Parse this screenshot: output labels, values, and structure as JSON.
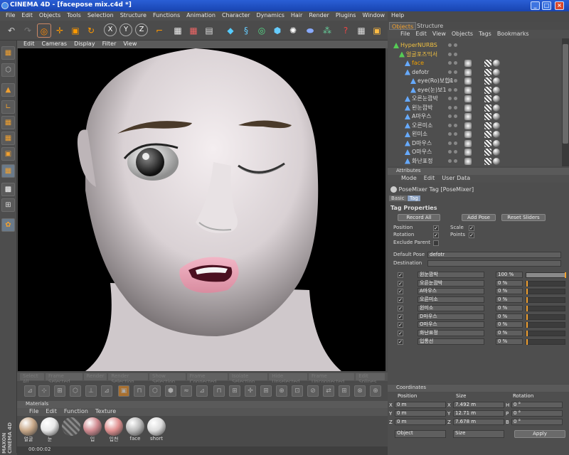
{
  "window": {
    "title": "CINEMA 4D - [facepose mix.c4d *]",
    "min": "_",
    "max": "□",
    "close": "×"
  },
  "menubar": [
    "File",
    "Edit",
    "Objects",
    "Tools",
    "Selection",
    "Structure",
    "Functions",
    "Animation",
    "Character",
    "Dynamics",
    "Hair",
    "Render",
    "Plugins",
    "Window",
    "Help"
  ],
  "viewport": {
    "menu": [
      "Edit",
      "Cameras",
      "Display",
      "Filter",
      "View"
    ]
  },
  "greyed_buttons": [
    "Select All",
    "Frame Selected",
    "Render",
    "Render Selection",
    "Show Selection",
    "Frame Connected",
    "Isolate Selection",
    "Hide Unselected",
    "Frame Unconnected",
    "Edit Splines"
  ],
  "materials": {
    "title": "Materials",
    "menu": [
      "File",
      "Edit",
      "Function",
      "Texture"
    ],
    "items": [
      {
        "label": "얼굴",
        "color": "#c8a888"
      },
      {
        "label": "눈",
        "color": "#e8e8e8"
      },
      {
        "label": "",
        "color": "stripe"
      },
      {
        "label": "입",
        "color": "#d08a90"
      },
      {
        "label": "입천",
        "color": "#e09090"
      },
      {
        "label": "face",
        "color": "#bbb"
      },
      {
        "label": "short",
        "color": "#ddd"
      }
    ]
  },
  "status": {
    "time": "00:00:02"
  },
  "maxon": "MAXON CINEMA 4D",
  "objects": {
    "tabs": [
      "Objects",
      "Structure"
    ],
    "menu": [
      "File",
      "Edit",
      "View",
      "Objects",
      "Tags",
      "Bookmarks"
    ],
    "tree": [
      {
        "name": "HyperNURBS",
        "indent": 0,
        "color": "#f0c040"
      },
      {
        "name": "얼굴포즈믹서",
        "indent": 1,
        "color": "#f0c040"
      },
      {
        "name": "face",
        "indent": 2,
        "color": "#f0a000"
      },
      {
        "name": "defotr",
        "indent": 2,
        "color": "#ddd"
      },
      {
        "name": "eye(Ro)보합1",
        "indent": 3,
        "color": "#ddd"
      },
      {
        "name": "eye(눈)보1",
        "indent": 3,
        "color": "#ddd"
      },
      {
        "name": "오른눈깜박",
        "indent": 2,
        "color": "#ddd"
      },
      {
        "name": "왼눈깜박",
        "indent": 2,
        "color": "#ddd"
      },
      {
        "name": "A마우스",
        "indent": 2,
        "color": "#ddd"
      },
      {
        "name": "오른미소",
        "indent": 2,
        "color": "#ddd"
      },
      {
        "name": "왼미소",
        "indent": 2,
        "color": "#ddd"
      },
      {
        "name": "D마우스",
        "indent": 2,
        "color": "#ddd"
      },
      {
        "name": "O마우스",
        "indent": 2,
        "color": "#ddd"
      },
      {
        "name": "화난표정",
        "indent": 2,
        "color": "#ddd"
      }
    ]
  },
  "attributes": {
    "title": "Attributes",
    "menu": [
      "Mode",
      "Edit",
      "User Data"
    ],
    "tag_title": "PoseMixer Tag [PoseMixer]",
    "tabs": [
      "Basic",
      "Tag"
    ],
    "section": "Tag Properties",
    "buttons": {
      "record": "Record All",
      "add": "Add Pose",
      "reset": "Reset Sliders"
    },
    "props": {
      "position": "Position",
      "rotation": "Rotation",
      "scale": "Scale",
      "points": "Points",
      "exclude": "Exclude Parent"
    },
    "default_pose_label": "Default Pose",
    "default_pose_value": "defotr",
    "destination_label": "Destination",
    "poses": [
      {
        "name": "왼눈깜박",
        "value": "100 %",
        "level": 1.0
      },
      {
        "name": "오른눈깜박",
        "value": "0 %",
        "level": 0
      },
      {
        "name": "A마우스",
        "value": "0 %",
        "level": 0
      },
      {
        "name": "오른미소",
        "value": "0 %",
        "level": 0
      },
      {
        "name": "왼미소",
        "value": "0 %",
        "level": 0
      },
      {
        "name": "D마우스",
        "value": "0 %",
        "level": 0
      },
      {
        "name": "O마우스",
        "value": "0 %",
        "level": 0
      },
      {
        "name": "화난표정",
        "value": "0 %",
        "level": 0
      },
      {
        "name": "입통선",
        "value": "0 %",
        "level": 0
      }
    ]
  },
  "coordinates": {
    "title": "Coordinates",
    "headers": [
      "Position",
      "Size",
      "Rotation"
    ],
    "rows": [
      {
        "axis": "X",
        "pos": "0 m",
        "saxis": "X",
        "size": "7.492 m",
        "raxis": "H",
        "rot": "0 °"
      },
      {
        "axis": "Y",
        "pos": "0 m",
        "saxis": "Y",
        "size": "12.71 m",
        "raxis": "P",
        "rot": "0 °"
      },
      {
        "axis": "Z",
        "pos": "0 m",
        "saxis": "Z",
        "size": "7.678 m",
        "raxis": "B",
        "rot": "0 °"
      }
    ],
    "mode1": "Object",
    "mode2": "Size",
    "apply": "Apply"
  }
}
